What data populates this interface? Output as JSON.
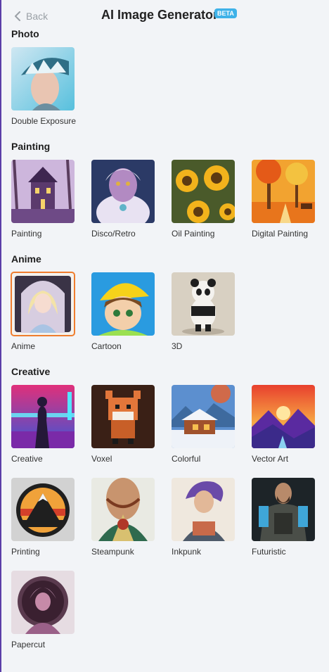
{
  "header": {
    "back_label": "Back",
    "title": "AI Image Generator",
    "badge": "BETA"
  },
  "sections": {
    "photo": "Photo",
    "painting": "Painting",
    "anime": "Anime",
    "creative": "Creative"
  },
  "styles": {
    "double_exposure": "Double Exposure",
    "painting": "Painting",
    "disco_retro": "Disco/Retro",
    "oil_painting": "Oil Painting",
    "digital_painting": "Digital Painting",
    "anime": "Anime",
    "cartoon": "Cartoon",
    "three_d": "3D",
    "creative": "Creative",
    "voxel": "Voxel",
    "colorful": "Colorful",
    "vector_art": "Vector Art",
    "printing": "Printing",
    "steampunk": "Steampunk",
    "inkpunk": "Inkpunk",
    "futuristic": "Futuristic",
    "papercut": "Papercut"
  },
  "colors": {
    "accent_selected": "#ef7d2e",
    "beta_badge": "#3fb2e8",
    "window_border": "#5b3fa8"
  }
}
